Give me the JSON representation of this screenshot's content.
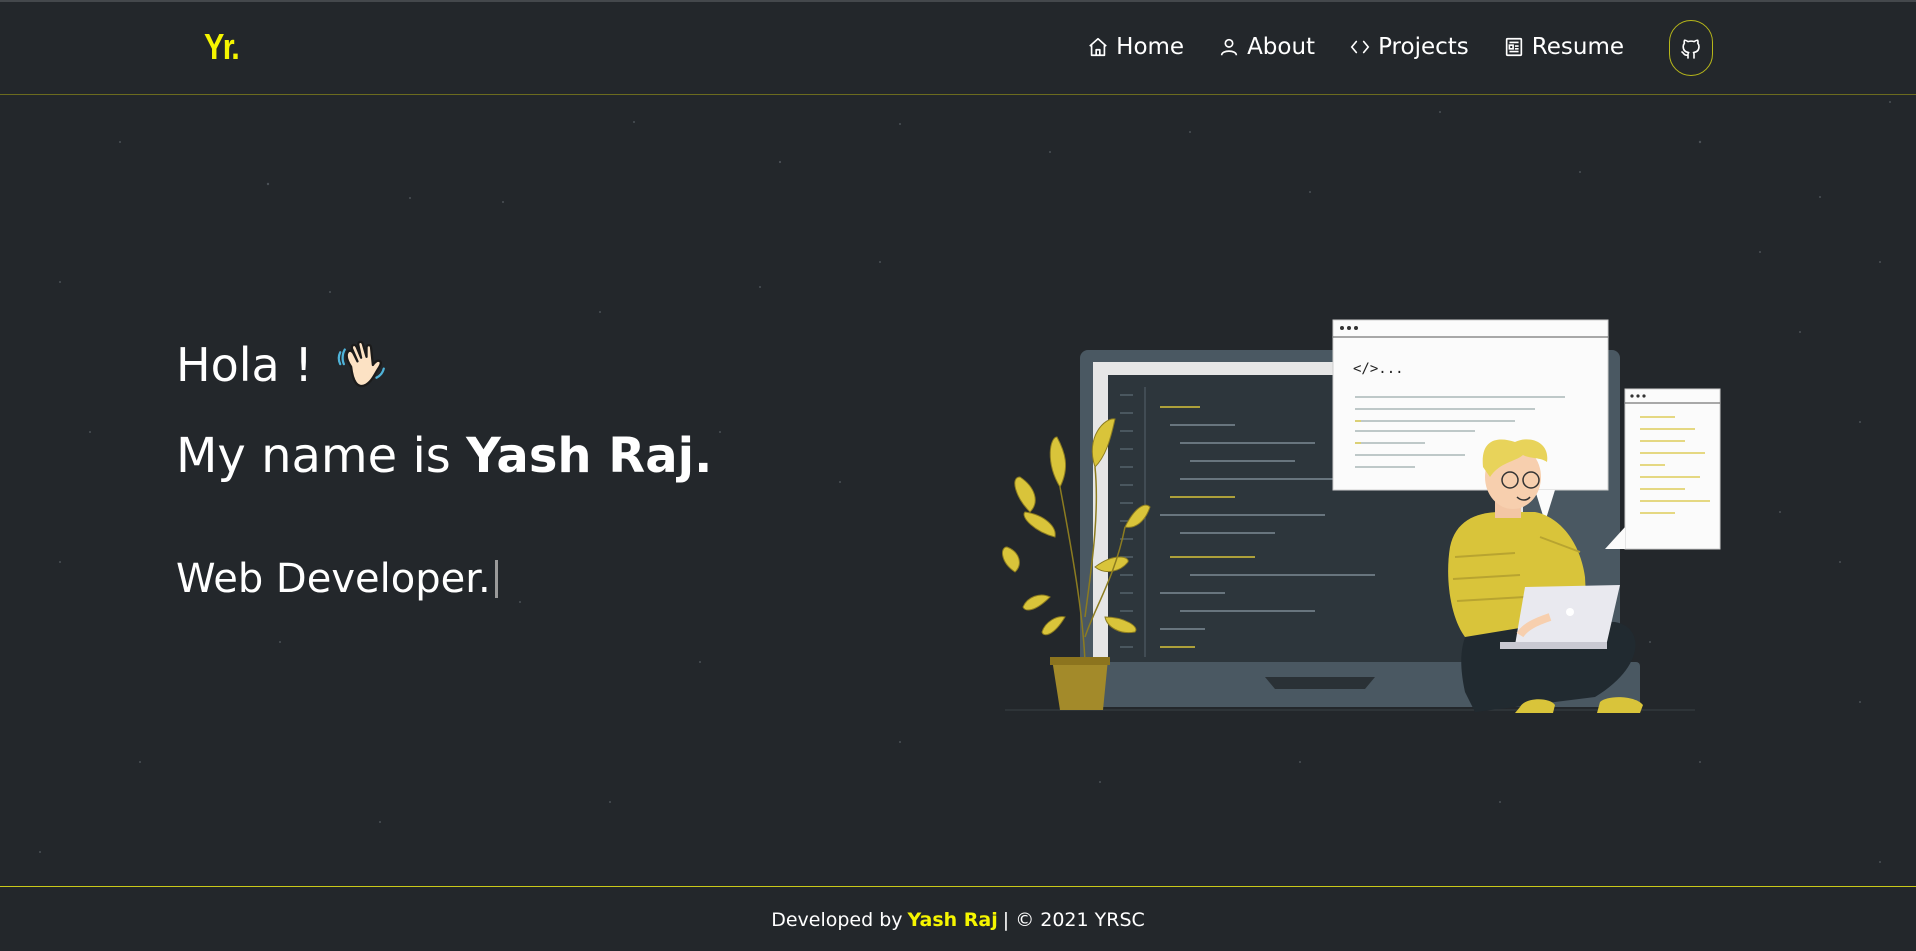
{
  "brand": {
    "logo_text": "Yr.",
    "accent_color": "#f5f500"
  },
  "nav": {
    "items": [
      {
        "label": "Home",
        "icon": "home-icon"
      },
      {
        "label": "About",
        "icon": "user-icon"
      },
      {
        "label": "Projects",
        "icon": "code-icon"
      },
      {
        "label": "Resume",
        "icon": "document-icon"
      }
    ],
    "github_icon": "github-icon"
  },
  "hero": {
    "greeting": "Hola !",
    "greeting_emoji": "waving-hand-icon",
    "name_prefix": "My name is",
    "name": "Yash Raj.",
    "role": "Web Developer.",
    "illustration": "developer-with-laptop-illustration",
    "illustration_code_text": "</>..."
  },
  "footer": {
    "prefix": "Developed by",
    "author": "Yash Raj",
    "suffix": "| © 2021 YRSC"
  },
  "colors": {
    "background": "#23272b",
    "text": "#ffffff",
    "accent": "#f5f500"
  }
}
